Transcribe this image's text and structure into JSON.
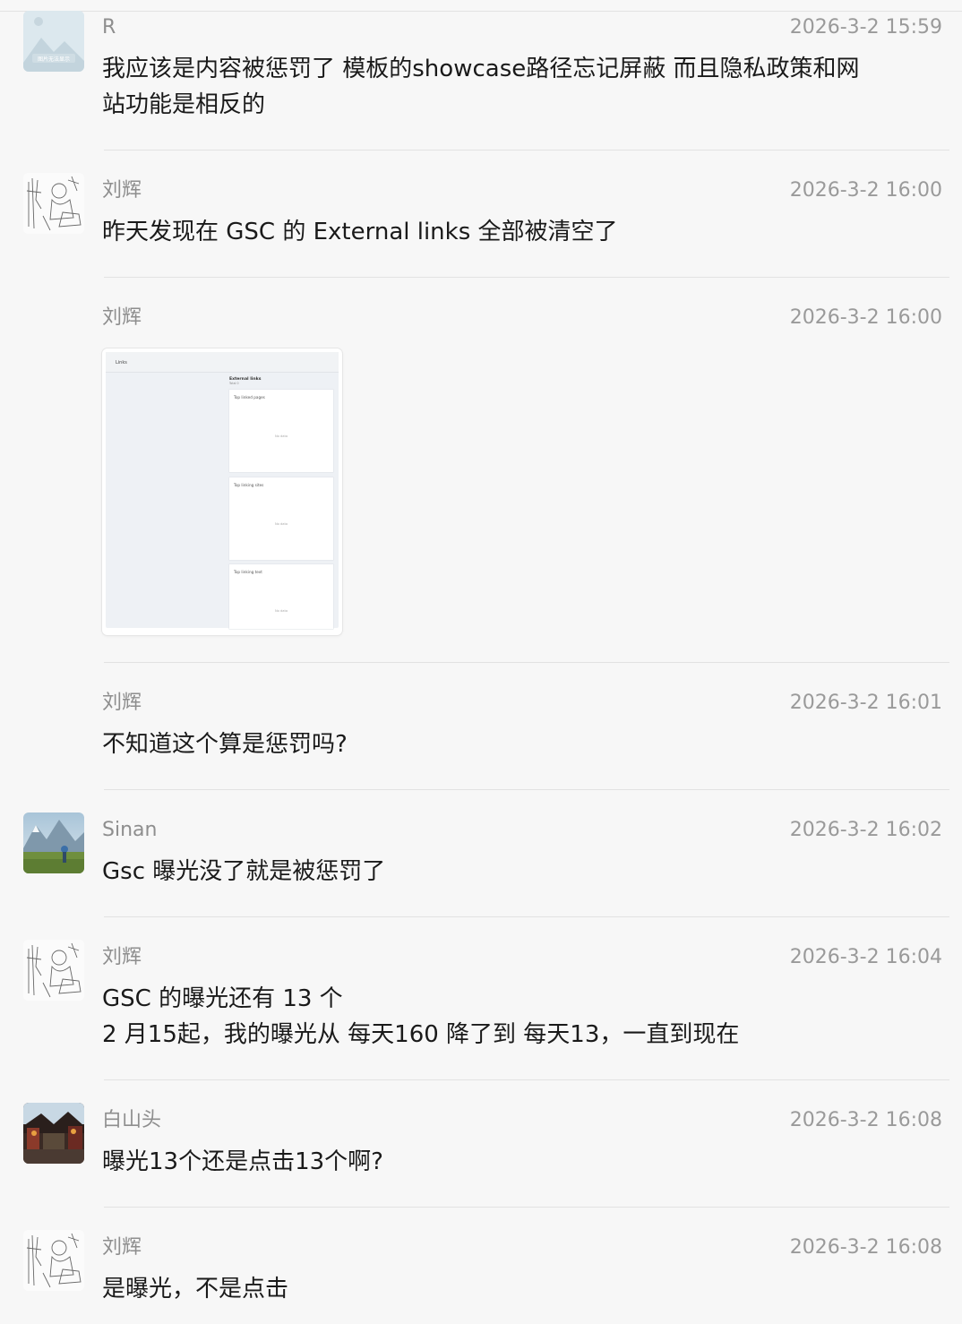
{
  "messages": [
    {
      "sender": "R",
      "time": "2026-3-2 15:59",
      "lines": [
        "我应该是内容被惩罚了  模板的showcase路径忘记屏蔽  而且隐私政策和网",
        "站功能是相反的"
      ],
      "avatar": "mountain-placeholder-avatar",
      "avatar_caption": "图片无法显示"
    },
    {
      "sender": "刘辉",
      "time": "2026-3-2 16:00",
      "lines": [
        "昨天发现在 GSC 的 External links 全部被清空了"
      ],
      "avatar": "sketch-avatar"
    },
    {
      "sender": "刘辉",
      "time": "2026-3-2 16:00",
      "image": {
        "header": "Links",
        "section": "External links",
        "section_sub": "Total 0",
        "cards": [
          {
            "title": "Top linked pages",
            "empty": "No data"
          },
          {
            "title": "Top linking sites",
            "empty": "No data"
          },
          {
            "title": "Top linking text",
            "empty": "No data"
          }
        ]
      }
    },
    {
      "sender": "刘辉",
      "time": "2026-3-2 16:01",
      "lines": [
        "不知道这个算是惩罚吗?"
      ]
    },
    {
      "sender": "Sinan",
      "time": "2026-3-2 16:02",
      "lines": [
        "Gsc 曝光没了就是被惩罚了"
      ],
      "avatar": "mountain-photo-avatar"
    },
    {
      "sender": "刘辉",
      "time": "2026-3-2 16:04",
      "lines": [
        "GSC 的曝光还有 13 个",
        "2 月15起，我的曝光从 每天160 降了到 每天13，一直到现在"
      ],
      "avatar": "sketch-avatar"
    },
    {
      "sender": "白山头",
      "time": "2026-3-2 16:08",
      "lines": [
        "曝光13个还是点击13个啊?"
      ],
      "avatar": "town-painting-avatar"
    },
    {
      "sender": "刘辉",
      "time": "2026-3-2 16:08",
      "lines": [
        "是曝光，不是点击"
      ],
      "avatar": "sketch-avatar"
    }
  ],
  "colors": {
    "background": "#f7f7f7",
    "text": "#1a1a1a",
    "meta": "#9a9a9a",
    "separator": "#e2e2e2"
  }
}
